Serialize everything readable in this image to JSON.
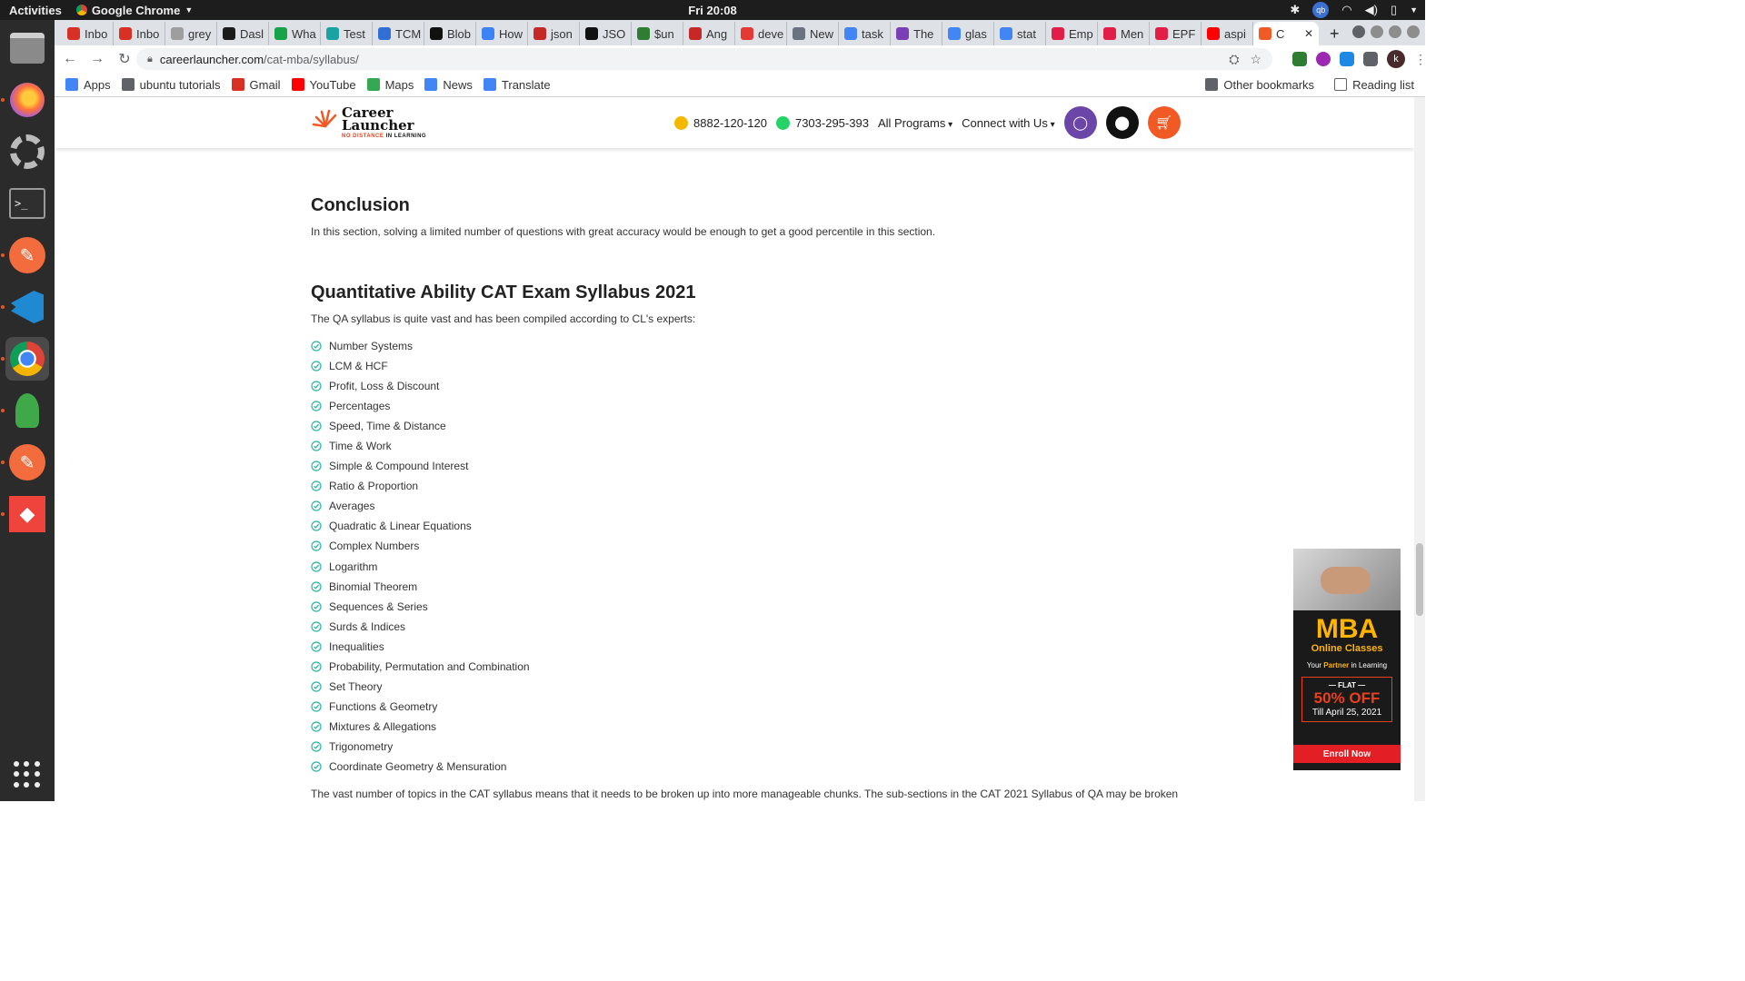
{
  "topbar": {
    "activities": "Activities",
    "app_name": "Google Chrome",
    "clock": "Fri 20:08",
    "qb": "qb"
  },
  "browser": {
    "tabs": [
      {
        "label": "Inbo",
        "color": "#d93025"
      },
      {
        "label": "Inbo",
        "color": "#d93025"
      },
      {
        "label": "grey",
        "color": "#9e9e9e"
      },
      {
        "label": "Dasl",
        "color": "#1b1b1b"
      },
      {
        "label": "Wha",
        "color": "#16a34a"
      },
      {
        "label": "Test",
        "color": "#1aa3a3"
      },
      {
        "label": "TCM",
        "color": "#2f6fd6"
      },
      {
        "label": "Blob",
        "color": "#111111"
      },
      {
        "label": "How",
        "color": "#3b82f6"
      },
      {
        "label": "json",
        "color": "#c62828"
      },
      {
        "label": "JSO",
        "color": "#111111"
      },
      {
        "label": "$un",
        "color": "#2e7d32"
      },
      {
        "label": "Ang",
        "color": "#c62828"
      },
      {
        "label": "deve",
        "color": "#e53935"
      },
      {
        "label": "New",
        "color": "#6b7280"
      },
      {
        "label": "task",
        "color": "#4285f4"
      },
      {
        "label": "The",
        "color": "#7b3fb5"
      },
      {
        "label": "glas",
        "color": "#4285f4"
      },
      {
        "label": "stat",
        "color": "#4285f4"
      },
      {
        "label": "Emp",
        "color": "#e11d48"
      },
      {
        "label": "Men",
        "color": "#e11d48"
      },
      {
        "label": "EPF",
        "color": "#e11d48"
      },
      {
        "label": "aspi",
        "color": "#ff0000"
      }
    ],
    "active_tab": {
      "label": "C",
      "close": "✕"
    },
    "new_tab": "+",
    "url_domain": "careerlauncher.com",
    "url_path": "/cat-mba/syllabus/",
    "profile_initial": "k",
    "bookmarks": [
      {
        "label": "Apps",
        "color": "#4285f4"
      },
      {
        "label": "ubuntu tutorials",
        "color": "#5f6368"
      },
      {
        "label": "Gmail",
        "color": "#d93025"
      },
      {
        "label": "YouTube",
        "color": "#ff0000"
      },
      {
        "label": "Maps",
        "color": "#34a853"
      },
      {
        "label": "News",
        "color": "#4285f4"
      },
      {
        "label": "Translate",
        "color": "#4285f4"
      }
    ],
    "other_bookmarks": "Other bookmarks",
    "reading_list": "Reading list"
  },
  "site_header": {
    "logo_line1": "Career",
    "logo_line2": "Launcher",
    "logo_tagline_1": "NO DISTANCE",
    "logo_tagline_2": "IN LEARNING",
    "phone1": "8882-120-120",
    "phone2": "7303-295-393",
    "all_programs": "All Programs",
    "connect": "Connect with Us",
    "accent": "#f15a24",
    "user_color": "#6b46a8"
  },
  "content": {
    "conclusion_title": "Conclusion",
    "conclusion_text": "In this section, solving a limited number of questions with great accuracy would be enough to get a good percentile in this section.",
    "qa_title": "Quantitative Ability CAT Exam Syllabus 2021",
    "qa_intro": "The QA syllabus is quite vast and has been compiled according to CL's experts:",
    "topics": [
      "Number Systems",
      "LCM & HCF",
      "Profit, Loss & Discount",
      "Percentages",
      "Speed, Time & Distance",
      "Time & Work",
      "Simple & Compound Interest",
      "Ratio & Proportion",
      "Averages",
      "Quadratic & Linear Equations",
      "Complex Numbers",
      "Logarithm",
      "Binomial Theorem",
      "Sequences & Series",
      "Surds & Indices",
      "Inequalities",
      "Probability, Permutation and Combination",
      "Set Theory",
      "Functions & Geometry",
      "Mixtures & Allegations",
      "Trigonometry",
      "Coordinate Geometry & Mensuration"
    ],
    "footer_text": "The vast number of topics in the CAT syllabus means that it needs to be broken up into more manageable chunks. The sub-sections in the CAT 2021 Syllabus of QA may be broken",
    "check_color": "#2bb3a3"
  },
  "ad": {
    "close": "✕",
    "mba": "MBA",
    "online": "Online Classes",
    "partner_pre": "Your ",
    "partner_hl": "Partner",
    "partner_post": " in Learning",
    "flat": "— FLAT —",
    "pct": "50% OFF",
    "till": "Till April 25, 2021",
    "enroll": "Enroll Now"
  }
}
